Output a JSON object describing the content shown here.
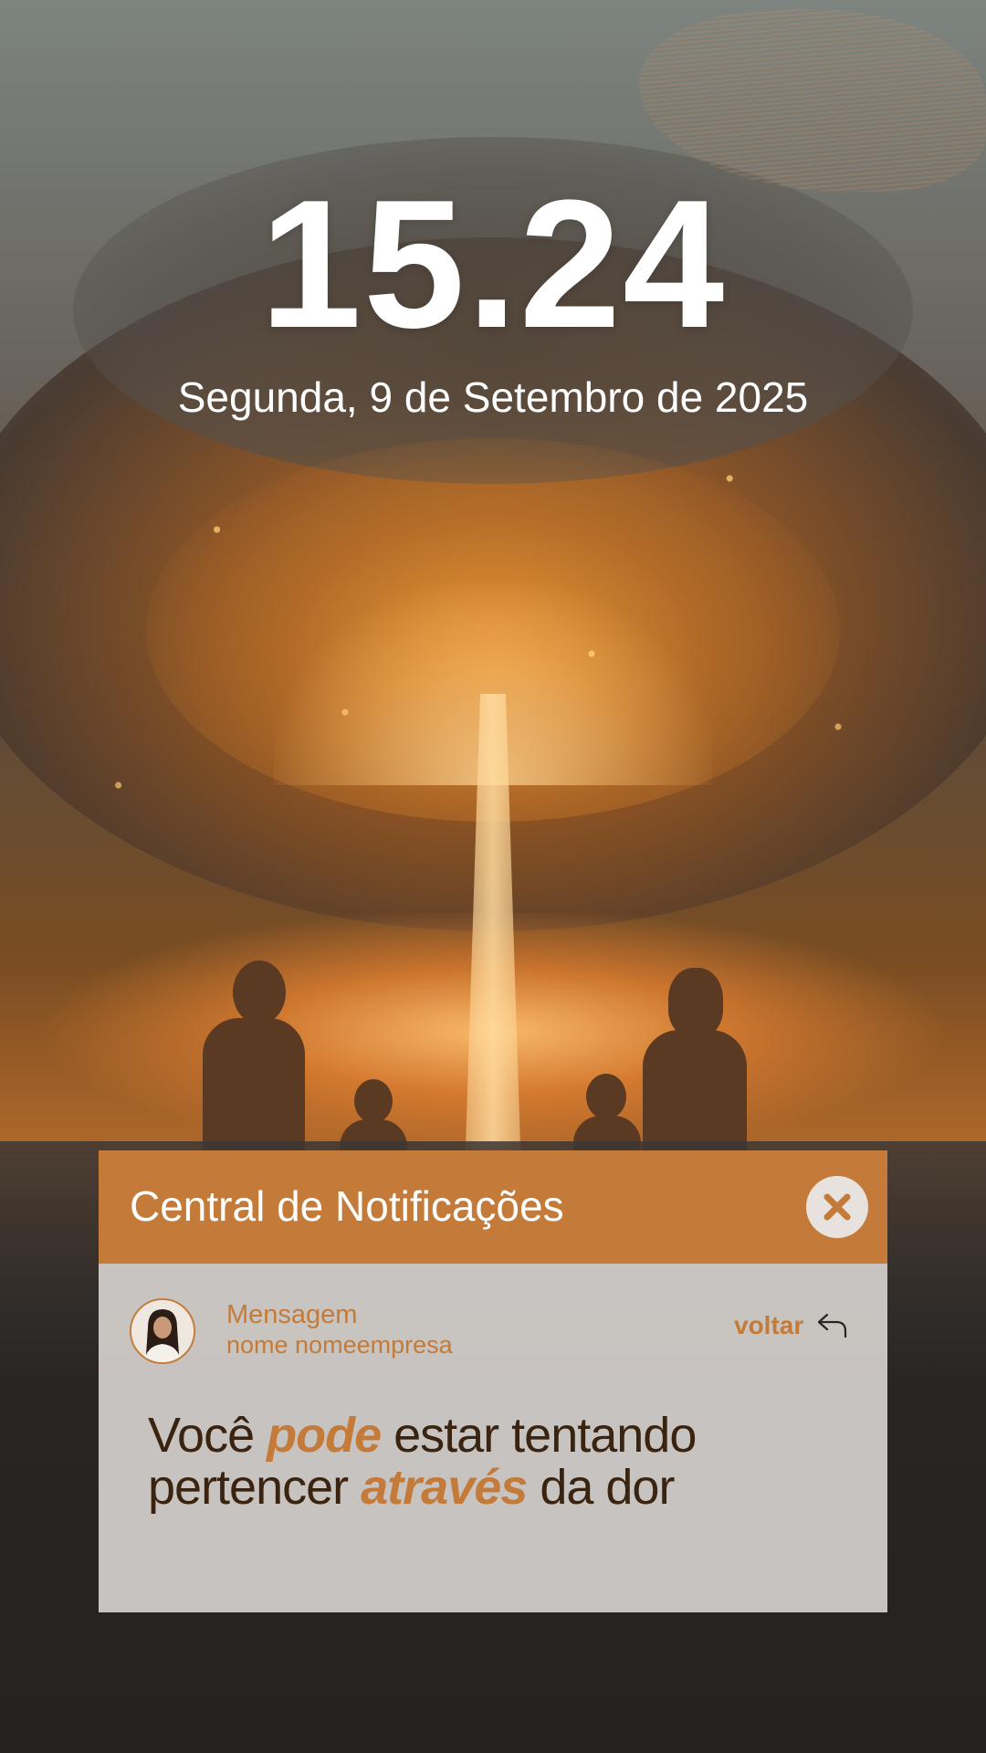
{
  "lockscreen": {
    "time": "15.24",
    "date": "Segunda, 9 de Setembro de 2025"
  },
  "notification_center": {
    "title": "Central de Notificações",
    "close_icon": "close-icon",
    "message_label": "Mensagem",
    "sender": "nome nomeempresa",
    "back_label": "voltar",
    "back_icon": "reply-arrow-icon",
    "message_parts": {
      "p1": "Você ",
      "p2": "pode",
      "p3": " estar tentando pertencer ",
      "p4": "através",
      "p5": " da dor"
    }
  },
  "colors": {
    "accent": "#c47b39",
    "text_dark": "#3a230f",
    "card_body": "#d4d0cc"
  }
}
